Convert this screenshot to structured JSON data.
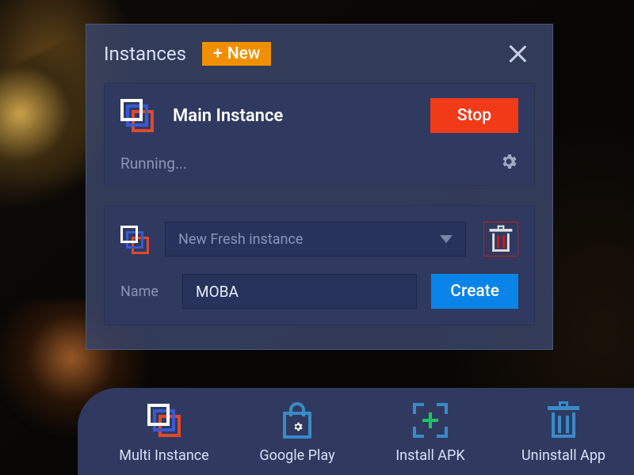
{
  "dialog": {
    "title": "Instances",
    "new_label": "New",
    "instance_name": "Main Instance",
    "stop_label": "Stop",
    "running_text": "Running...",
    "template_select": "New Fresh instance",
    "name_label": "Name",
    "name_value": "MOBA",
    "create_label": "Create"
  },
  "toolbar": {
    "multi_instance": "Multi Instance",
    "google_play": "Google Play",
    "install_apk": "Install APK",
    "uninstall_app": "Uninstall App"
  }
}
